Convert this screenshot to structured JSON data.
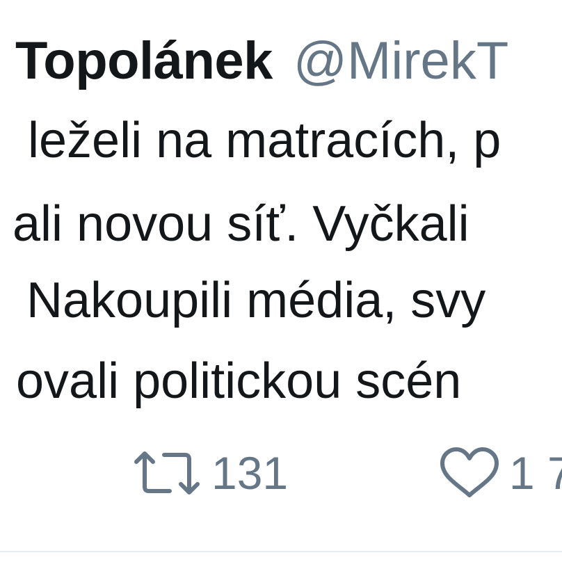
{
  "tweet": {
    "display_name": "Topolánek",
    "handle": "@MirekT",
    "lines": [
      "leželi na matracích, p",
      "ali novou síť. Vyčkali",
      "Nakoupili média, svy",
      "ovali politickou scén"
    ],
    "actions": {
      "retweet_icon": "retweet-icon",
      "retweet_count": "131",
      "like_icon": "heart-icon",
      "like_count": "1 7"
    }
  },
  "colors": {
    "text": "#14171a",
    "secondary": "#657786",
    "divider": "#e6ecf0"
  }
}
